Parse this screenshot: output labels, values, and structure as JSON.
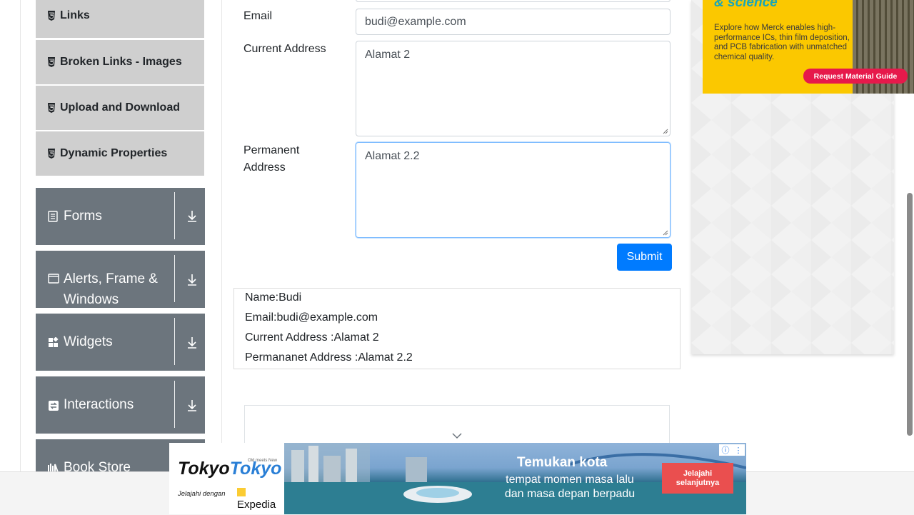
{
  "sidebar": {
    "items": [
      {
        "label": "Links",
        "icon": "html5-icon"
      },
      {
        "label": "Broken Links - Images",
        "icon": "html5-icon"
      },
      {
        "label": "Upload and Download",
        "icon": "html5-icon"
      },
      {
        "label": "Dynamic Properties",
        "icon": "html5-icon"
      }
    ],
    "groups": [
      {
        "label": "Forms",
        "icon": "form-icon"
      },
      {
        "label": "Alerts, Frame & Windows",
        "icon": "window-icon"
      },
      {
        "label": "Widgets",
        "icon": "widgets-icon"
      },
      {
        "label": "Interactions",
        "icon": "interactions-icon"
      },
      {
        "label": "Book Store",
        "icon": "bookstore-icon"
      }
    ]
  },
  "form": {
    "email_label": "Email",
    "email_value": "budi@example.com",
    "current_address_label": "Current Address",
    "current_address_value": "Alamat 2",
    "permanent_address_label_line1": "Permanent",
    "permanent_address_label_line2": "Address",
    "permanent_address_value": "Alamat 2.2",
    "submit_label": "Submit"
  },
  "output": {
    "name": "Name:Budi",
    "email": "Email:budi@example.com",
    "current_address": "Current Address :Alamat 2",
    "permanent_address": "Permananet Address :Alamat 2.2"
  },
  "right_ad": {
    "headline": "& science",
    "body": "Explore how Merck enables high-performance ICs, thin film deposition, and PCB fabrication with unmatched chemical quality.",
    "cta": "Request Material Guide"
  },
  "bottom_ad": {
    "brand_part1": "Tokyo",
    "brand_part2": "Tokyo",
    "brand_tagline": "Old meets New",
    "jelajahi": "Jelajahi dengan",
    "expedia": "Expedia",
    "title": "Temukan kota",
    "subtitle": "tempat momen masa lalu dan masa depan berpadu",
    "cta": "Jelajahi selanjutnya"
  },
  "colors": {
    "primary": "#007bff",
    "sidebar_group": "#6c757d",
    "sidebar_item": "#cfcfcf",
    "ad_yellow": "#fbc800",
    "ad_cta": "#e6194b"
  }
}
